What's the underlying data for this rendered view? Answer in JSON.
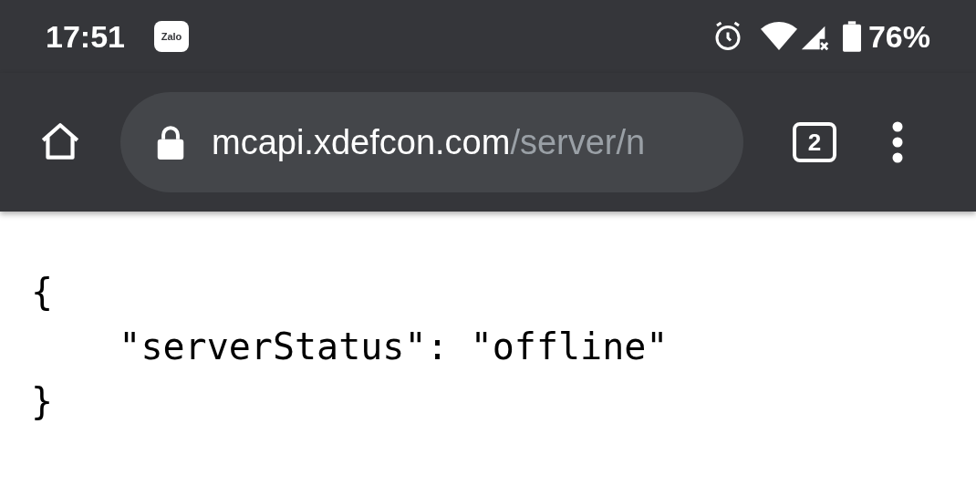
{
  "status_bar": {
    "time": "17:51",
    "app_badge": "Zalo",
    "battery": "76%"
  },
  "toolbar": {
    "url": {
      "host": "mcapi.xdefcon.com",
      "path": "/server/n"
    },
    "tab_count": "2"
  },
  "page": {
    "lines": [
      "{",
      "    \"serverStatus\": \"offline\"",
      "}"
    ]
  }
}
